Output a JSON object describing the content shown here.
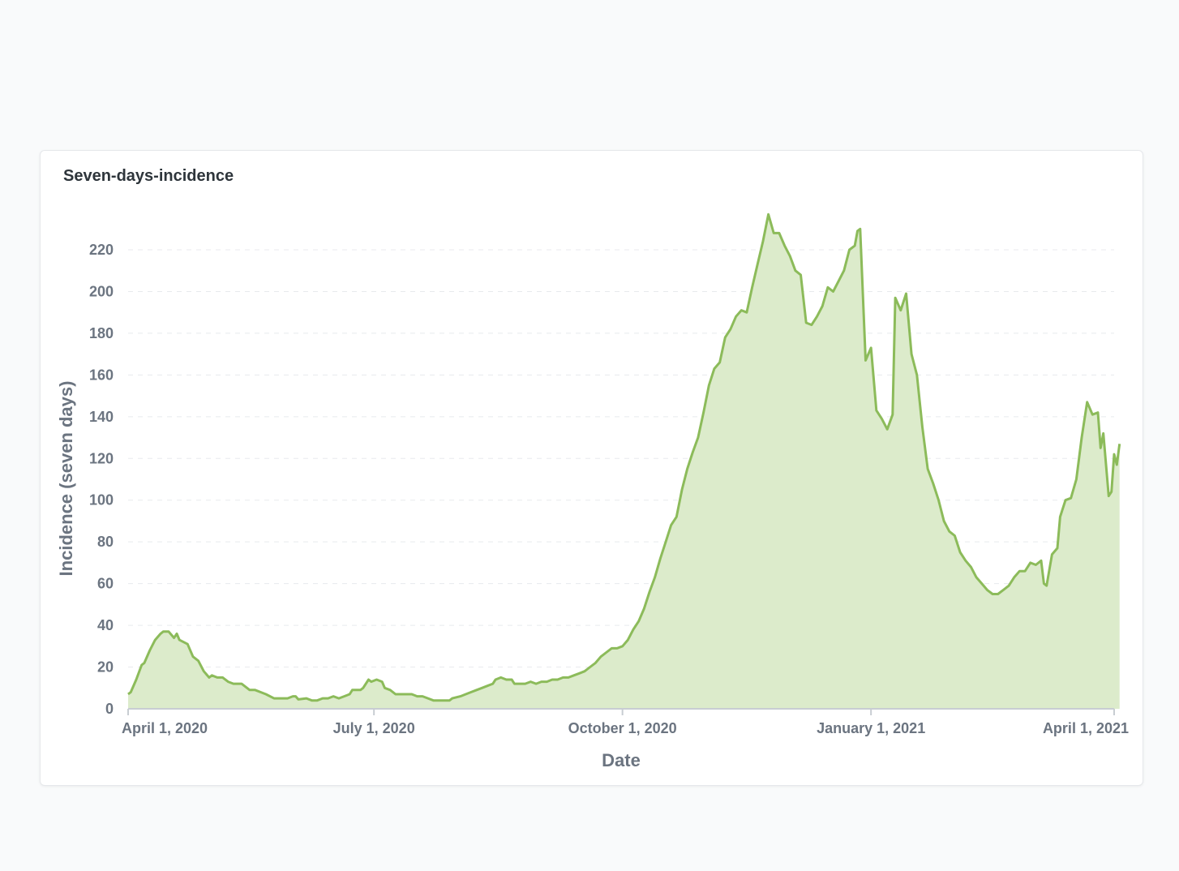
{
  "card": {
    "title": "Seven-days-incidence"
  },
  "colors": {
    "line": "#8cbb5a",
    "fill": "#dcebcb",
    "grid": "#e8eaed",
    "axis": "#c8cdd2",
    "text": "#6b7480"
  },
  "chart_data": {
    "type": "area",
    "title": "Seven-days-incidence",
    "xlabel": "Date",
    "ylabel": "Incidence (seven days)",
    "ylim": [
      0,
      230
    ],
    "xlim": [
      "2020-04-01",
      "2021-04-01"
    ],
    "yticks": [
      0,
      20,
      40,
      60,
      80,
      100,
      120,
      140,
      160,
      180,
      200,
      220
    ],
    "xticks": [
      {
        "date": "2020-04-01",
        "label": "April 1, 2020"
      },
      {
        "date": "2020-07-01",
        "label": "July 1, 2020"
      },
      {
        "date": "2020-10-01",
        "label": "October 1, 2020"
      },
      {
        "date": "2021-01-01",
        "label": "January 1, 2021"
      },
      {
        "date": "2021-04-01",
        "label": "April 1, 2021"
      }
    ],
    "grid": true,
    "series": [
      {
        "points": [
          [
            "2020-04-01",
            7
          ],
          [
            "2020-04-02",
            8
          ],
          [
            "2020-04-04",
            14
          ],
          [
            "2020-04-06",
            21
          ],
          [
            "2020-04-07",
            22
          ],
          [
            "2020-04-09",
            28
          ],
          [
            "2020-04-11",
            33
          ],
          [
            "2020-04-13",
            36
          ],
          [
            "2020-04-14",
            37
          ],
          [
            "2020-04-16",
            37
          ],
          [
            "2020-04-18",
            34
          ],
          [
            "2020-04-19",
            36
          ],
          [
            "2020-04-20",
            33
          ],
          [
            "2020-04-23",
            31
          ],
          [
            "2020-04-25",
            25
          ],
          [
            "2020-04-27",
            23
          ],
          [
            "2020-04-29",
            18
          ],
          [
            "2020-05-01",
            15
          ],
          [
            "2020-05-02",
            16
          ],
          [
            "2020-05-04",
            15
          ],
          [
            "2020-05-06",
            15
          ],
          [
            "2020-05-08",
            13
          ],
          [
            "2020-05-10",
            12
          ],
          [
            "2020-05-13",
            12
          ],
          [
            "2020-05-14",
            11
          ],
          [
            "2020-05-16",
            9
          ],
          [
            "2020-05-18",
            9
          ],
          [
            "2020-05-20",
            8
          ],
          [
            "2020-05-22",
            7
          ],
          [
            "2020-05-25",
            5
          ],
          [
            "2020-05-30",
            5
          ],
          [
            "2020-06-01",
            6
          ],
          [
            "2020-06-02",
            6
          ],
          [
            "2020-06-03",
            4.5
          ],
          [
            "2020-06-06",
            5
          ],
          [
            "2020-06-08",
            4
          ],
          [
            "2020-06-10",
            4
          ],
          [
            "2020-06-12",
            5
          ],
          [
            "2020-06-14",
            5
          ],
          [
            "2020-06-16",
            6
          ],
          [
            "2020-06-18",
            5
          ],
          [
            "2020-06-20",
            6
          ],
          [
            "2020-06-22",
            7
          ],
          [
            "2020-06-23",
            9
          ],
          [
            "2020-06-26",
            9
          ],
          [
            "2020-06-27",
            10
          ],
          [
            "2020-06-29",
            14
          ],
          [
            "2020-06-30",
            13
          ],
          [
            "2020-07-02",
            14
          ],
          [
            "2020-07-04",
            13
          ],
          [
            "2020-07-05",
            10
          ],
          [
            "2020-07-07",
            9
          ],
          [
            "2020-07-09",
            7
          ],
          [
            "2020-07-11",
            7
          ],
          [
            "2020-07-13",
            7
          ],
          [
            "2020-07-15",
            7
          ],
          [
            "2020-07-17",
            6
          ],
          [
            "2020-07-19",
            6
          ],
          [
            "2020-07-21",
            5
          ],
          [
            "2020-07-23",
            4
          ],
          [
            "2020-07-25",
            4
          ],
          [
            "2020-07-27",
            4
          ],
          [
            "2020-07-29",
            4
          ],
          [
            "2020-07-30",
            5
          ],
          [
            "2020-08-02",
            6
          ],
          [
            "2020-08-04",
            7
          ],
          [
            "2020-08-06",
            8
          ],
          [
            "2020-08-08",
            9
          ],
          [
            "2020-08-10",
            10
          ],
          [
            "2020-08-12",
            11
          ],
          [
            "2020-08-14",
            12
          ],
          [
            "2020-08-15",
            14
          ],
          [
            "2020-08-17",
            15
          ],
          [
            "2020-08-19",
            14
          ],
          [
            "2020-08-21",
            14
          ],
          [
            "2020-08-22",
            12
          ],
          [
            "2020-08-24",
            12
          ],
          [
            "2020-08-26",
            12
          ],
          [
            "2020-08-28",
            13
          ],
          [
            "2020-08-30",
            12
          ],
          [
            "2020-09-01",
            13
          ],
          [
            "2020-09-03",
            13
          ],
          [
            "2020-09-05",
            14
          ],
          [
            "2020-09-07",
            14
          ],
          [
            "2020-09-09",
            15
          ],
          [
            "2020-09-11",
            15
          ],
          [
            "2020-09-13",
            16
          ],
          [
            "2020-09-15",
            17
          ],
          [
            "2020-09-17",
            18
          ],
          [
            "2020-09-19",
            20
          ],
          [
            "2020-09-21",
            22
          ],
          [
            "2020-09-23",
            25
          ],
          [
            "2020-09-25",
            27
          ],
          [
            "2020-09-27",
            29
          ],
          [
            "2020-09-29",
            29
          ],
          [
            "2020-10-01",
            30
          ],
          [
            "2020-10-03",
            33
          ],
          [
            "2020-10-05",
            38
          ],
          [
            "2020-10-07",
            42
          ],
          [
            "2020-10-09",
            48
          ],
          [
            "2020-10-11",
            56
          ],
          [
            "2020-10-13",
            63
          ],
          [
            "2020-10-15",
            72
          ],
          [
            "2020-10-17",
            80
          ],
          [
            "2020-10-19",
            88
          ],
          [
            "2020-10-21",
            92
          ],
          [
            "2020-10-23",
            105
          ],
          [
            "2020-10-25",
            115
          ],
          [
            "2020-10-27",
            123
          ],
          [
            "2020-10-29",
            130
          ],
          [
            "2020-10-31",
            142
          ],
          [
            "2020-11-02",
            155
          ],
          [
            "2020-11-04",
            163
          ],
          [
            "2020-11-06",
            166
          ],
          [
            "2020-11-08",
            178
          ],
          [
            "2020-11-10",
            182
          ],
          [
            "2020-11-12",
            188
          ],
          [
            "2020-11-14",
            191
          ],
          [
            "2020-11-16",
            190
          ],
          [
            "2020-11-18",
            202
          ],
          [
            "2020-11-20",
            213
          ],
          [
            "2020-11-22",
            224
          ],
          [
            "2020-11-24",
            237
          ],
          [
            "2020-11-26",
            228
          ],
          [
            "2020-11-28",
            228
          ],
          [
            "2020-11-30",
            222
          ],
          [
            "2020-12-02",
            217
          ],
          [
            "2020-12-04",
            210
          ],
          [
            "2020-12-06",
            208
          ],
          [
            "2020-12-08",
            185
          ],
          [
            "2020-12-10",
            184
          ],
          [
            "2020-12-12",
            188
          ],
          [
            "2020-12-14",
            193
          ],
          [
            "2020-12-16",
            202
          ],
          [
            "2020-12-18",
            200
          ],
          [
            "2020-12-20",
            205
          ],
          [
            "2020-12-22",
            210
          ],
          [
            "2020-12-24",
            220
          ],
          [
            "2020-12-26",
            222
          ],
          [
            "2020-12-27",
            229
          ],
          [
            "2020-12-28",
            230
          ],
          [
            "2020-12-30",
            167
          ],
          [
            "2021-01-01",
            173
          ],
          [
            "2021-01-03",
            143
          ],
          [
            "2021-01-05",
            139
          ],
          [
            "2021-01-07",
            134
          ],
          [
            "2021-01-09",
            141
          ],
          [
            "2021-01-10",
            197
          ],
          [
            "2021-01-12",
            191
          ],
          [
            "2021-01-14",
            199
          ],
          [
            "2021-01-16",
            170
          ],
          [
            "2021-01-18",
            160
          ],
          [
            "2021-01-20",
            135
          ],
          [
            "2021-01-22",
            115
          ],
          [
            "2021-01-24",
            108
          ],
          [
            "2021-01-26",
            100
          ],
          [
            "2021-01-28",
            90
          ],
          [
            "2021-01-30",
            85
          ],
          [
            "2021-02-01",
            83
          ],
          [
            "2021-02-03",
            75
          ],
          [
            "2021-02-05",
            71
          ],
          [
            "2021-02-07",
            68
          ],
          [
            "2021-02-09",
            63
          ],
          [
            "2021-02-11",
            60
          ],
          [
            "2021-02-13",
            57
          ],
          [
            "2021-02-15",
            55
          ],
          [
            "2021-02-17",
            55
          ],
          [
            "2021-02-19",
            57
          ],
          [
            "2021-02-21",
            59
          ],
          [
            "2021-02-23",
            63
          ],
          [
            "2021-02-25",
            66
          ],
          [
            "2021-02-27",
            66
          ],
          [
            "2021-03-01",
            70
          ],
          [
            "2021-03-03",
            69
          ],
          [
            "2021-03-05",
            71
          ],
          [
            "2021-03-06",
            60
          ],
          [
            "2021-03-07",
            59
          ],
          [
            "2021-03-09",
            74
          ],
          [
            "2021-03-11",
            77
          ],
          [
            "2021-03-12",
            92
          ],
          [
            "2021-03-14",
            100
          ],
          [
            "2021-03-16",
            101
          ],
          [
            "2021-03-18",
            110
          ],
          [
            "2021-03-20",
            130
          ],
          [
            "2021-03-22",
            147
          ],
          [
            "2021-03-24",
            141
          ],
          [
            "2021-03-26",
            142
          ],
          [
            "2021-03-27",
            125
          ],
          [
            "2021-03-28",
            132
          ],
          [
            "2021-03-30",
            102
          ],
          [
            "2021-03-31",
            104
          ],
          [
            "2021-04-01",
            122
          ],
          [
            "2021-04-02",
            117
          ],
          [
            "2021-04-03",
            127
          ]
        ]
      }
    ]
  }
}
